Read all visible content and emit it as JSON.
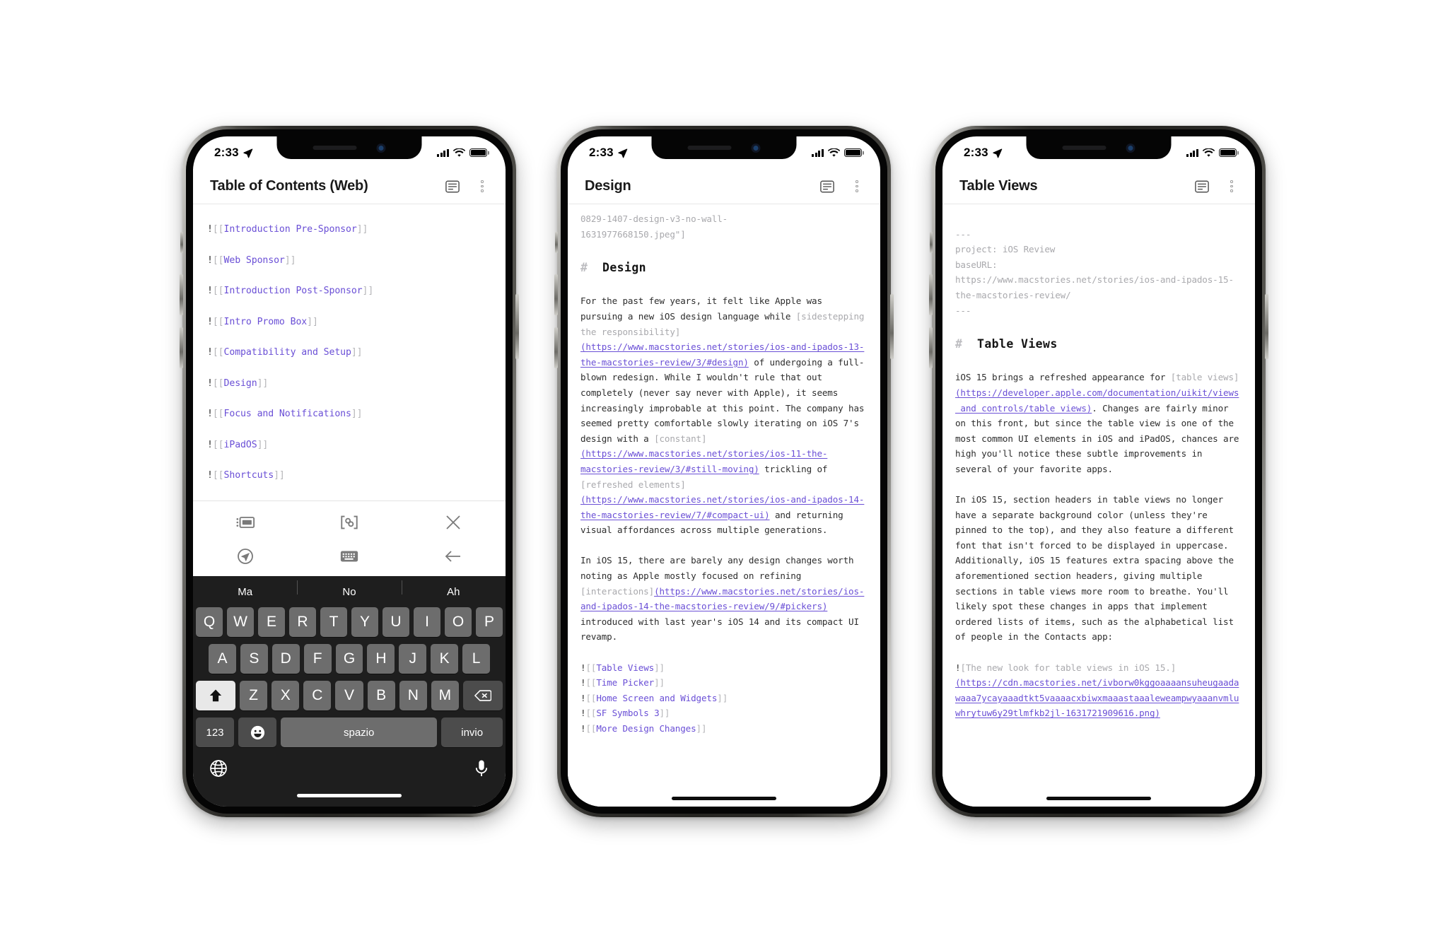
{
  "statusbar": {
    "time": "2:33",
    "location_icon": "location-arrow-icon",
    "signal_icon": "cellular-bars-icon",
    "wifi_icon": "wifi-icon",
    "battery_icon": "battery-full-icon"
  },
  "phones": [
    {
      "id": "phone-toc",
      "nav": {
        "title": "Table of Contents (Web)",
        "action1_icon": "text-format-icon",
        "action2_icon": "more-options-icon"
      },
      "toc_items": [
        {
          "bang": "!",
          "open": "[[",
          "name": "Introduction Pre-Sponsor",
          "close": "]]"
        },
        {
          "bang": "!",
          "open": "[[",
          "name": "Web Sponsor",
          "close": "]]"
        },
        {
          "bang": "!",
          "open": "[[",
          "name": "Introduction Post-Sponsor",
          "close": "]]"
        },
        {
          "bang": "!",
          "open": "[[",
          "name": "Intro Promo Box",
          "close": "]]"
        },
        {
          "bang": "!",
          "open": "[[",
          "name": "Compatibility and Setup",
          "close": "]]"
        },
        {
          "bang": "!",
          "open": "[[",
          "name": "Design",
          "close": "]]"
        },
        {
          "bang": "!",
          "open": "[[",
          "name": "Focus and Notifications",
          "close": "]]"
        },
        {
          "bang": "!",
          "open": "[[",
          "name": "iPadOS",
          "close": "]]"
        },
        {
          "bang": "!",
          "open": "[[",
          "name": "Shortcuts",
          "close": "]]"
        }
      ],
      "accessory": {
        "row1": [
          "card-list-icon",
          "wiki-link-icon",
          "close-x-icon"
        ],
        "row2": [
          "send-location-icon",
          "hide-keyboard-icon",
          "back-arrow-icon"
        ]
      },
      "keyboard": {
        "suggestions": [
          "Ma",
          "No",
          "Ah"
        ],
        "row1": [
          "Q",
          "W",
          "E",
          "R",
          "T",
          "Y",
          "U",
          "I",
          "O",
          "P"
        ],
        "row2": [
          "A",
          "S",
          "D",
          "F",
          "G",
          "H",
          "J",
          "K",
          "L"
        ],
        "row3": [
          "Z",
          "X",
          "C",
          "V",
          "B",
          "N",
          "M"
        ],
        "shift_label": "shift-up-icon",
        "backspace_label": "backspace-icon",
        "numbers_label": "123",
        "emoji_label": "emoji-icon",
        "space_label": "spazio",
        "enter_label": "invio",
        "globe_label": "globe-icon",
        "mic_label": "microphone-icon"
      }
    },
    {
      "id": "phone-design",
      "nav": {
        "title": "Design",
        "action1_icon": "text-format-icon",
        "action2_icon": "more-options-icon"
      },
      "lines": [
        {
          "type": "plain-dim",
          "text": "0829-1407-design-v3-no-wall-"
        },
        {
          "type": "plain-dim",
          "text": "1631977668150.jpeg\"]"
        },
        {
          "type": "gap"
        },
        {
          "type": "heading",
          "hash": "#",
          "text": "Design"
        },
        {
          "type": "gap"
        },
        {
          "type": "rich",
          "parts": [
            {
              "c": "t",
              "v": "For the past few years, it felt like Apple was pursuing a new iOS design language while "
            },
            {
              "c": "dim",
              "v": "[sidestepping the responsibility]"
            },
            {
              "c": "lnk",
              "v": "(https://www.macstories.net/stories/ios-and-ipados-13-the-macstories-review/3/#design)"
            },
            {
              "c": "t",
              "v": " of undergoing a full-blown redesign. While I wouldn't rule that out completely (never say never with Apple), it seems increasingly improbable at this point. The company has seemed pretty comfortable slowly iterating on iOS 7's design with a "
            },
            {
              "c": "dim",
              "v": "[constant]"
            },
            {
              "c": "lnk",
              "v": "(https://www.macstories.net/stories/ios-11-the-macstories-review/3/#still-moving)"
            },
            {
              "c": "t",
              "v": " trickling of "
            },
            {
              "c": "dim",
              "v": "[refreshed elements]"
            },
            {
              "c": "lnk",
              "v": "(https://www.macstories.net/stories/ios-and-ipados-14-the-macstories-review/7/#compact-ui)"
            },
            {
              "c": "t",
              "v": " and returning visual affordances across multiple generations."
            }
          ]
        },
        {
          "type": "gap"
        },
        {
          "type": "rich",
          "parts": [
            {
              "c": "t",
              "v": "In iOS 15, there are barely any design changes worth noting as Apple mostly focused on refining "
            },
            {
              "c": "dim",
              "v": "[interactions]"
            },
            {
              "c": "lnk",
              "v": "(https://www.macstories.net/stories/ios-and-ipados-14-the-macstories-review/9/#pickers)"
            },
            {
              "c": "t",
              "v": " introduced with last year's iOS 14 and its compact UI revamp."
            }
          ]
        },
        {
          "type": "gap"
        },
        {
          "type": "wiki",
          "name": "Table Views"
        },
        {
          "type": "wiki",
          "name": "Time Picker"
        },
        {
          "type": "wiki",
          "name": "Home Screen and Widgets"
        },
        {
          "type": "wiki",
          "name": "SF Symbols 3"
        },
        {
          "type": "wiki",
          "name": "More Design Changes"
        }
      ]
    },
    {
      "id": "phone-table-views",
      "nav": {
        "title": "Table Views",
        "action1_icon": "text-format-icon",
        "action2_icon": "more-options-icon"
      },
      "lines": [
        {
          "type": "gap"
        },
        {
          "type": "plain-dim",
          "text": "---"
        },
        {
          "type": "plain-dim",
          "text": "project: iOS Review"
        },
        {
          "type": "plain-dim",
          "text": "baseURL:"
        },
        {
          "type": "plain-dim",
          "text": "https://www.macstories.net/stories/ios-and-ipados-15-the-macstories-review/"
        },
        {
          "type": "plain-dim",
          "text": "---"
        },
        {
          "type": "gap"
        },
        {
          "type": "heading",
          "hash": "#",
          "text": "Table Views"
        },
        {
          "type": "gap"
        },
        {
          "type": "rich",
          "parts": [
            {
              "c": "t",
              "v": "iOS 15 brings a refreshed appearance for "
            },
            {
              "c": "dim",
              "v": "[table views]"
            },
            {
              "c": "lnk",
              "v": "(https://developer.apple.com/documentation/uikit/views_and_controls/table_views)"
            },
            {
              "c": "t",
              "v": ". Changes are fairly minor on this front, but since the table view is one of the most common UI elements in iOS and iPadOS, chances are high you'll notice these subtle improvements in several of your favorite apps."
            }
          ]
        },
        {
          "type": "gap"
        },
        {
          "type": "rich",
          "parts": [
            {
              "c": "t",
              "v": "In iOS 15, section headers in table views no longer have a separate background color (unless they're pinned to the top), and they also feature a different font that isn't forced to be displayed in uppercase. Additionally, iOS 15 features extra spacing above the aforementioned section headers, giving multiple sections in table views more room to breathe. You'll likely spot these changes in apps that implement ordered lists of items, such as the alphabetical list of people in the Contacts app:"
            }
          ]
        },
        {
          "type": "gap"
        },
        {
          "type": "rich",
          "parts": [
            {
              "c": "t",
              "v": "!"
            },
            {
              "c": "dim",
              "v": "[The new look for table views in iOS 15.]"
            },
            {
              "c": "lnk",
              "v": "(https://cdn.macstories.net/ivborw0kggoaaaansuheugaadawaaa7ycayaaadtkt5vaaaacxbiwxmaaastaaaleweampwyaaanvmluwhrytuw6y29tlmfkb2jl-1631721909616.png)"
            }
          ]
        }
      ]
    }
  ],
  "colors": {
    "wiki_link": "#6a4fd6",
    "punctuation": "#b5b5b8",
    "dim_text": "#a9a9ad",
    "body_text": "#2d2d2d",
    "keyboard_bg": "#1e1e1e",
    "key_bg": "#6d6d6d"
  }
}
